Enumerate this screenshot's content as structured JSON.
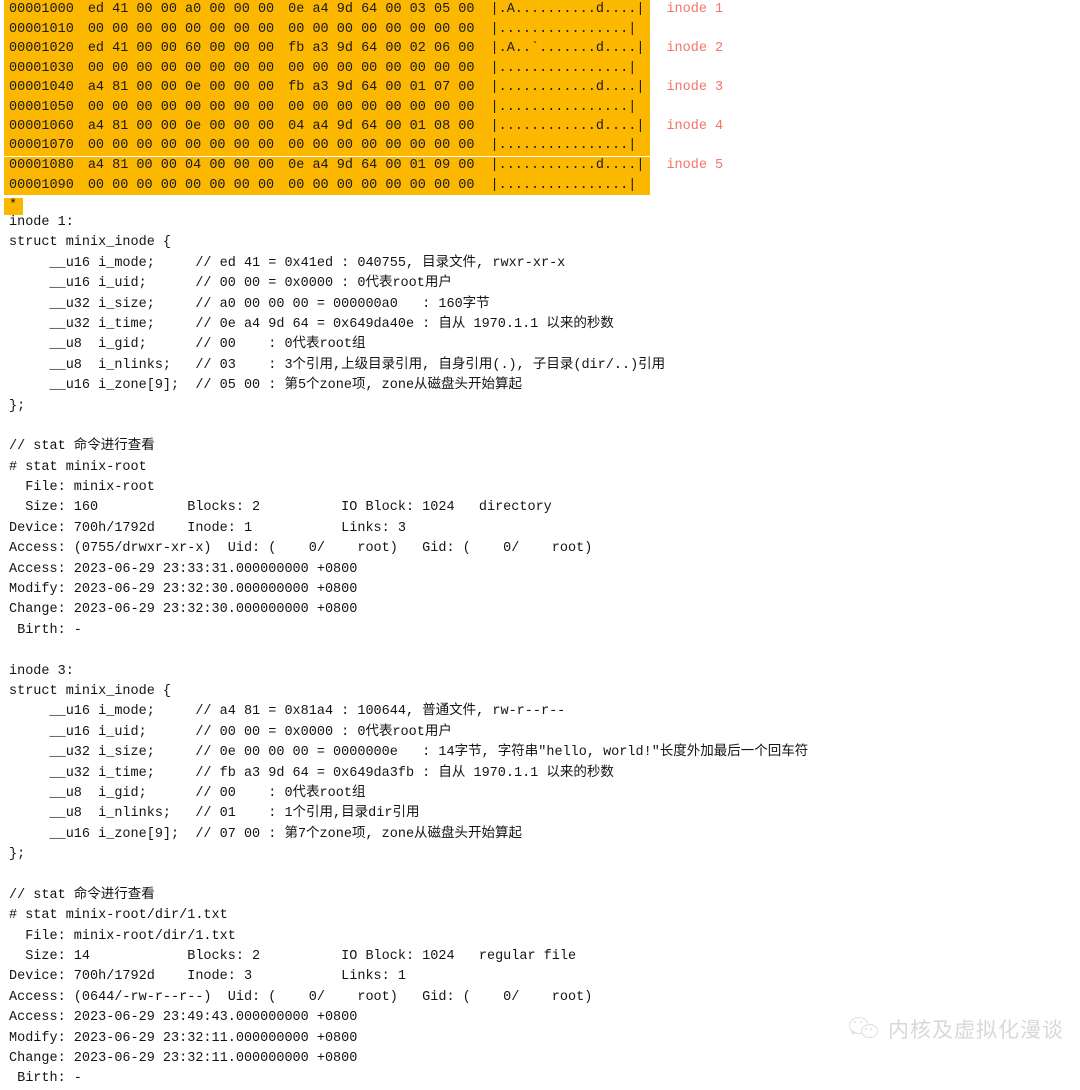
{
  "hexdump": {
    "rows": [
      {
        "offset": "00001000",
        "bytes_left": "ed 41 00 00 a0 00 00 00",
        "bytes_right": "0e a4 9d 64 00 03 05 00",
        "ascii": "|.A..........d....|",
        "inode_label": "inode 1",
        "separator_above": false
      },
      {
        "offset": "00001010",
        "bytes_left": "00 00 00 00 00 00 00 00",
        "bytes_right": "00 00 00 00 00 00 00 00",
        "ascii": "|................|",
        "inode_label": "",
        "separator_above": false
      },
      {
        "offset": "00001020",
        "bytes_left": "ed 41 00 00 60 00 00 00",
        "bytes_right": "fb a3 9d 64 00 02 06 00",
        "ascii": "|.A..`.......d....|",
        "inode_label": "inode 2",
        "separator_above": false
      },
      {
        "offset": "00001030",
        "bytes_left": "00 00 00 00 00 00 00 00",
        "bytes_right": "00 00 00 00 00 00 00 00",
        "ascii": "|................|",
        "inode_label": "",
        "separator_above": false
      },
      {
        "offset": "00001040",
        "bytes_left": "a4 81 00 00 0e 00 00 00",
        "bytes_right": "fb a3 9d 64 00 01 07 00",
        "ascii": "|............d....|",
        "inode_label": "inode 3",
        "separator_above": false
      },
      {
        "offset": "00001050",
        "bytes_left": "00 00 00 00 00 00 00 00",
        "bytes_right": "00 00 00 00 00 00 00 00",
        "ascii": "|................|",
        "inode_label": "",
        "separator_above": false
      },
      {
        "offset": "00001060",
        "bytes_left": "a4 81 00 00 0e 00 00 00",
        "bytes_right": "04 a4 9d 64 00 01 08 00",
        "ascii": "|............d....|",
        "inode_label": "inode 4",
        "separator_above": false
      },
      {
        "offset": "00001070",
        "bytes_left": "00 00 00 00 00 00 00 00",
        "bytes_right": "00 00 00 00 00 00 00 00",
        "ascii": "|................|",
        "inode_label": "",
        "separator_above": false
      },
      {
        "offset": "00001080",
        "bytes_left": "a4 81 00 00 04 00 00 00",
        "bytes_right": "0e a4 9d 64 00 01 09 00",
        "ascii": "|............d....|",
        "inode_label": "inode 5",
        "separator_above": true
      },
      {
        "offset": "00001090",
        "bytes_left": "00 00 00 00 00 00 00 00",
        "bytes_right": "00 00 00 00 00 00 00 00",
        "ascii": "|................|",
        "inode_label": "",
        "separator_above": false
      }
    ],
    "continuation_marker": "*",
    "highlight_color": "#fcb700",
    "inode_label_color": "#f4736a"
  },
  "body_lines": [
    "inode 1:",
    "struct minix_inode {",
    "     __u16 i_mode;     // ed 41 = 0x41ed : 040755, 目录文件, rwxr-xr-x",
    "     __u16 i_uid;      // 00 00 = 0x0000 : 0代表root用户",
    "     __u32 i_size;     // a0 00 00 00 = 000000a0   : 160字节",
    "     __u32 i_time;     // 0e a4 9d 64 = 0x649da40e : 自从 1970.1.1 以来的秒数",
    "     __u8  i_gid;      // 00    : 0代表root组",
    "     __u8  i_nlinks;   // 03    : 3个引用,上级目录引用, 自身引用(.), 子目录(dir/..)引用",
    "     __u16 i_zone[9];  // 05 00 : 第5个zone项, zone从磁盘头开始算起",
    "};",
    "",
    "// stat 命令进行查看",
    "# stat minix-root",
    "  File: minix-root",
    "  Size: 160           Blocks: 2          IO Block: 1024   directory",
    "Device: 700h/1792d    Inode: 1           Links: 3",
    "Access: (0755/drwxr-xr-x)  Uid: (    0/    root)   Gid: (    0/    root)",
    "Access: 2023-06-29 23:33:31.000000000 +0800",
    "Modify: 2023-06-29 23:32:30.000000000 +0800",
    "Change: 2023-06-29 23:32:30.000000000 +0800",
    " Birth: -",
    "",
    "inode 3:",
    "struct minix_inode {",
    "     __u16 i_mode;     // a4 81 = 0x81a4 : 100644, 普通文件, rw-r--r--",
    "     __u16 i_uid;      // 00 00 = 0x0000 : 0代表root用户",
    "     __u32 i_size;     // 0e 00 00 00 = 0000000e   : 14字节, 字符串\"hello, world!\"长度外加最后一个回车符",
    "     __u32 i_time;     // fb a3 9d 64 = 0x649da3fb : 自从 1970.1.1 以来的秒数",
    "     __u8  i_gid;      // 00    : 0代表root组",
    "     __u8  i_nlinks;   // 01    : 1个引用,目录dir引用",
    "     __u16 i_zone[9];  // 07 00 : 第7个zone项, zone从磁盘头开始算起",
    "};",
    "",
    "// stat 命令进行查看",
    "# stat minix-root/dir/1.txt",
    "  File: minix-root/dir/1.txt",
    "  Size: 14            Blocks: 2          IO Block: 1024   regular file",
    "Device: 700h/1792d    Inode: 3           Links: 1",
    "Access: (0644/-rw-r--r--)  Uid: (    0/    root)   Gid: (    0/    root)",
    "Access: 2023-06-29 23:49:43.000000000 +0800",
    "Modify: 2023-06-29 23:32:11.000000000 +0800",
    "Change: 2023-06-29 23:32:11.000000000 +0800",
    " Birth: -"
  ],
  "watermark": {
    "text": "内核及虚拟化漫谈",
    "icon": "wechat-icon",
    "color": "#b9b9b9"
  }
}
